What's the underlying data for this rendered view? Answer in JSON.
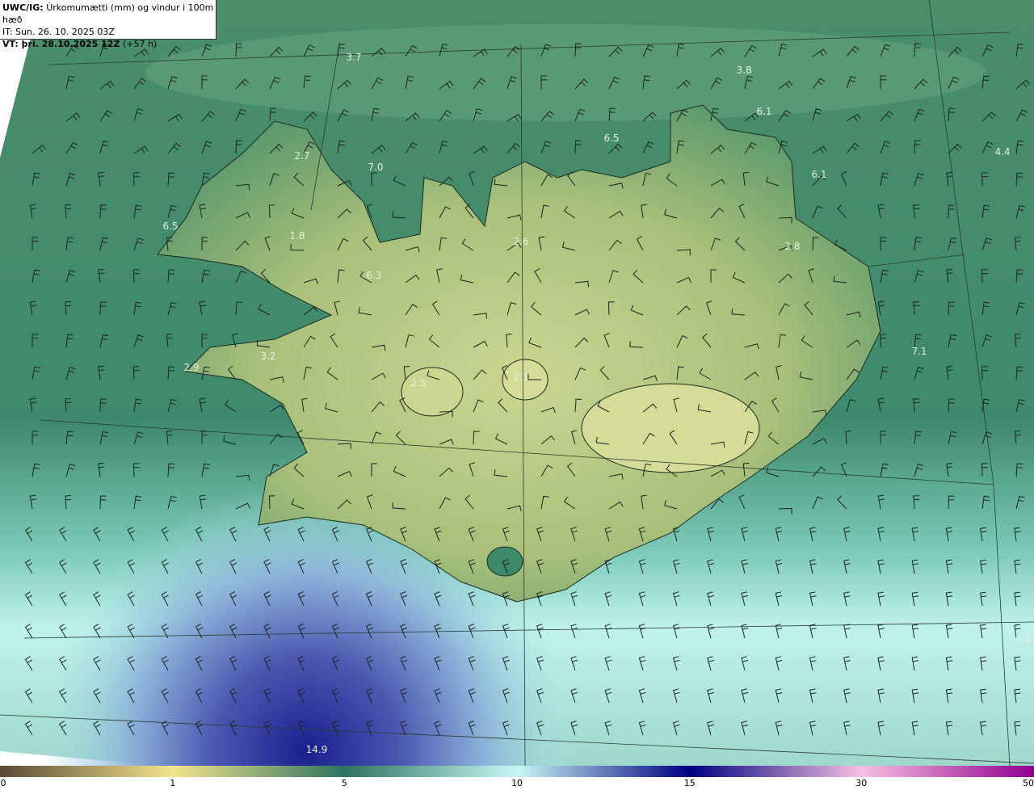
{
  "header": {
    "product": "UWC/IG:",
    "title": "Úrkomumætti (mm) og vindur i 100m hæð",
    "init_time": "IT: Sun. 26. 10. 2025 03Z",
    "valid_label": "VT: þri. 28.10.2025 12Z",
    "lead": "(+57 h)"
  },
  "map_labels": [
    "3.7",
    "3.8",
    "6.1",
    "6.5",
    "4.4",
    "2.7",
    "7.0",
    "6.1",
    "6.5",
    "1.8",
    "2.6",
    "6.3",
    "2.8",
    "7.1",
    "2.9",
    "3.2",
    "2.5",
    "2.1",
    "7.4",
    "14.9"
  ],
  "colorbar": {
    "ticks": [
      "0",
      "1",
      "5",
      "10",
      "15",
      "30",
      "50"
    ],
    "colors": [
      "#5a4a35",
      "#f2e48c",
      "#2c7460",
      "#c8f8f6",
      "#000080",
      "#f6c0e0",
      "#900090"
    ]
  }
}
